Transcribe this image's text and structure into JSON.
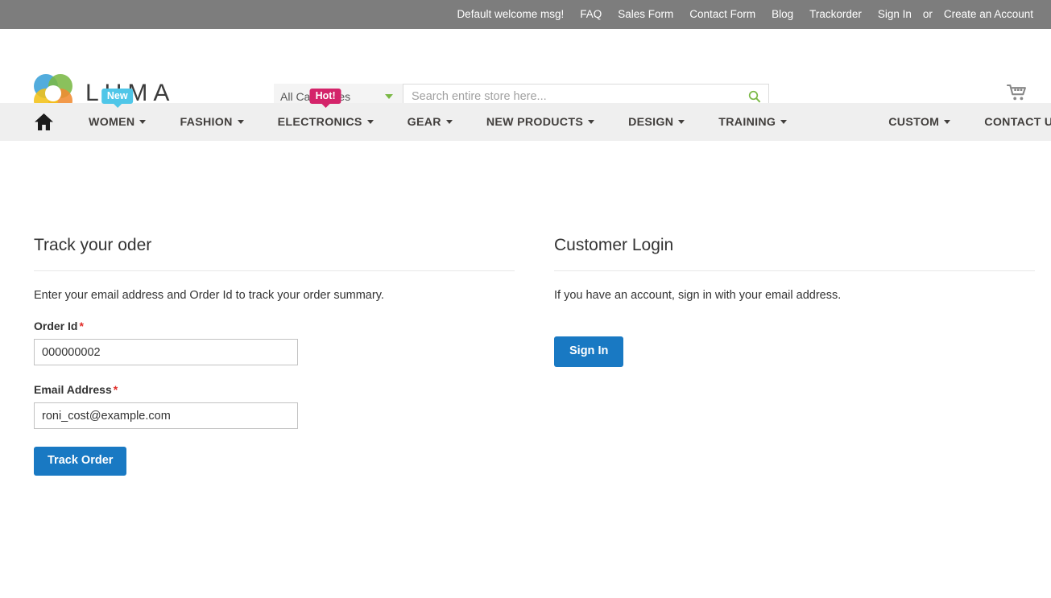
{
  "topbar": {
    "welcome_msg": "Default welcome msg!",
    "links": [
      {
        "label": "FAQ"
      },
      {
        "label": "Sales Form"
      },
      {
        "label": "Contact Form"
      },
      {
        "label": "Blog"
      },
      {
        "label": "Trackorder"
      },
      {
        "label": "Sign In"
      }
    ],
    "or_text": "or",
    "create_account": "Create an Account",
    "background_color": "#7d7d7d"
  },
  "header": {
    "logo_text": "LUMA",
    "logo_icon": "luma-ring-logo",
    "search": {
      "category_selected": "All Categories",
      "category_caret_icon": "chevron-down-icon",
      "placeholder": "Search entire store here...",
      "value": "",
      "search_icon": "search-icon",
      "search_icon_color": "#7ab845"
    },
    "cart_icon": "shopping-cart-icon"
  },
  "nav": {
    "home_icon": "home-icon",
    "items": [
      {
        "label": "WOMEN",
        "badge": "New",
        "badge_type": "new",
        "badge_color": "#4fc6e8",
        "caret": true
      },
      {
        "label": "FASHION",
        "badge": null,
        "caret": true
      },
      {
        "label": "ELECTRONICS",
        "badge": "Hot!",
        "badge_type": "hot",
        "badge_color": "#d4246a",
        "caret": true
      },
      {
        "label": "GEAR",
        "badge": null,
        "caret": true
      },
      {
        "label": "NEW PRODUCTS",
        "badge": null,
        "caret": true
      },
      {
        "label": "DESIGN",
        "badge": null,
        "caret": true
      },
      {
        "label": "TRAINING",
        "badge": null,
        "caret": true
      },
      {
        "label": "CUSTOM",
        "badge": null,
        "caret": true
      },
      {
        "label": "CONTACT US",
        "badge": null,
        "caret": true
      }
    ],
    "background_color": "#efefef"
  },
  "track_order": {
    "title": "Track your oder",
    "note": "Enter your email address and Order Id to track your order summary.",
    "order_id_label": "Order Id",
    "order_id_value": "000000002",
    "order_id_required_mark": "*",
    "email_label": "Email Address",
    "email_value": "roni_cost@example.com",
    "email_required_mark": "*",
    "submit_label": "Track Order",
    "submit_color": "#1979c3"
  },
  "customer_login": {
    "title": "Customer Login",
    "note": "If you have an account, sign in with your email address.",
    "signin_label": "Sign In",
    "signin_color": "#1979c3"
  }
}
